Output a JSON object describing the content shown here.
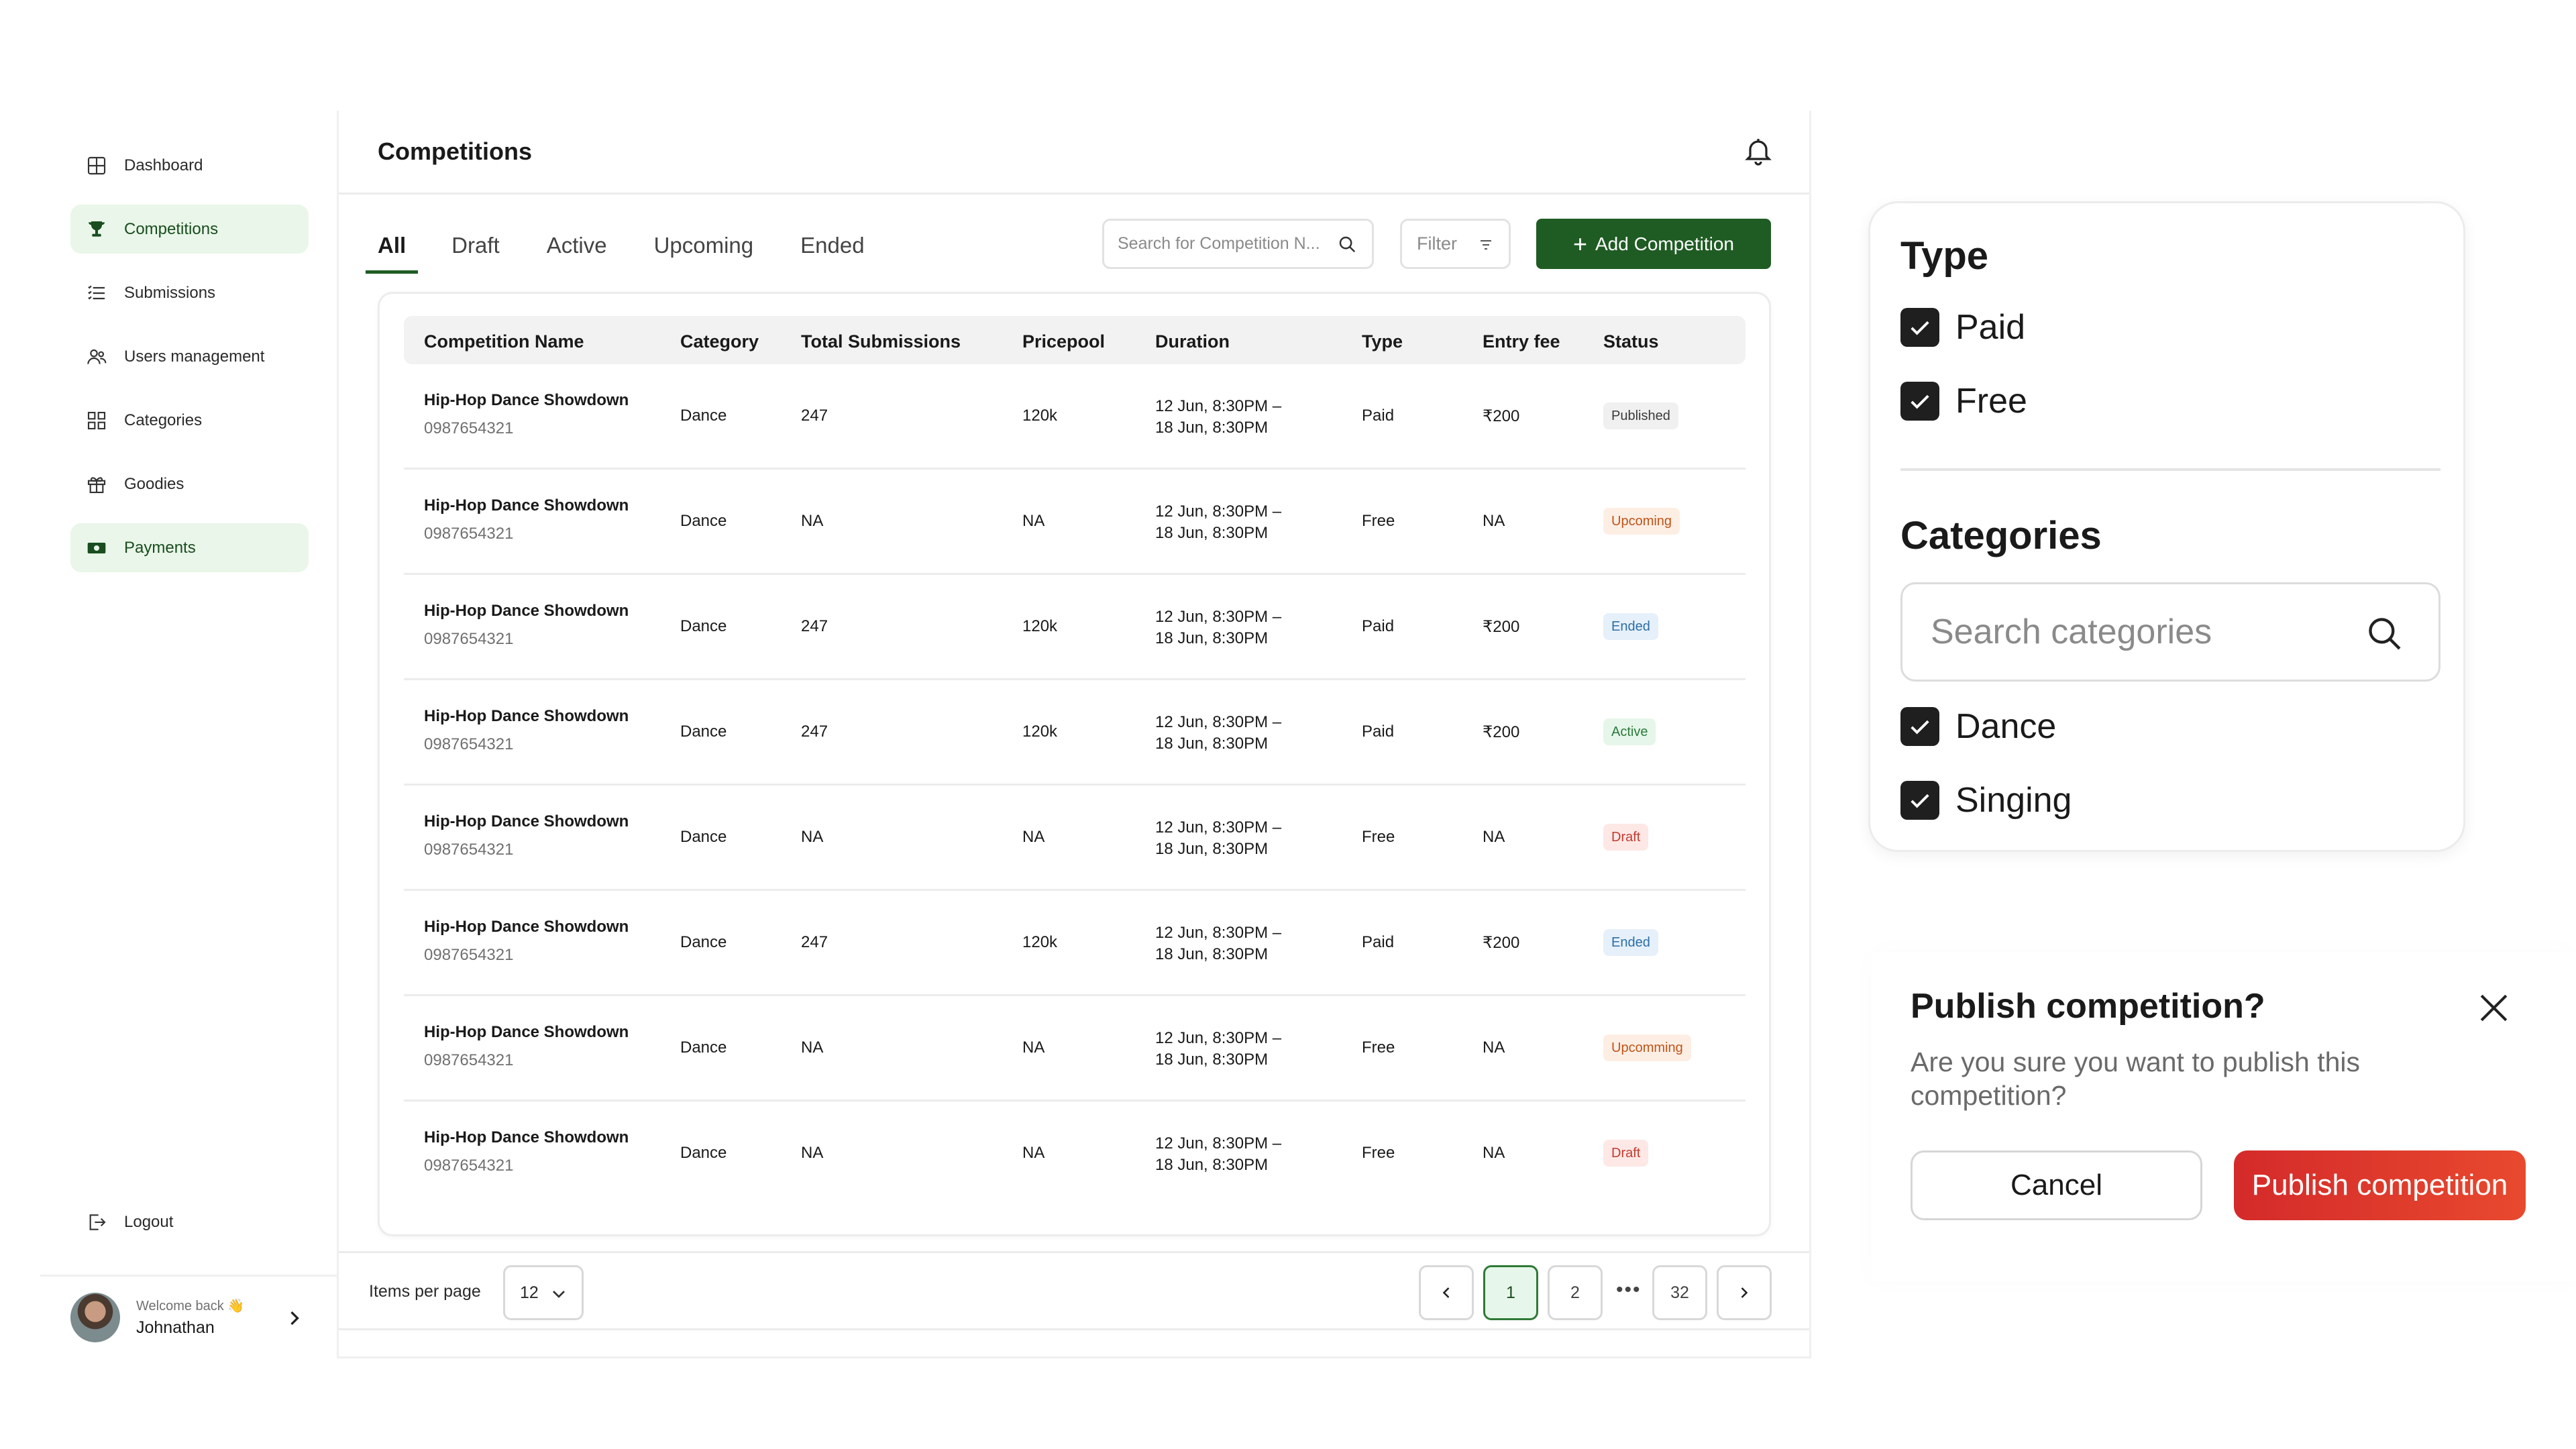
{
  "sidebar": {
    "items": [
      {
        "label": "Dashboard",
        "icon": "dashboard-icon",
        "active": false
      },
      {
        "label": "Competitions",
        "icon": "trophy-icon",
        "active": true
      },
      {
        "label": "Submissions",
        "icon": "list-icon",
        "active": false
      },
      {
        "label": "Users management",
        "icon": "users-icon",
        "active": false
      },
      {
        "label": "Categories",
        "icon": "grid-icon",
        "active": false
      },
      {
        "label": "Goodies",
        "icon": "gift-icon",
        "active": false
      },
      {
        "label": "Payments",
        "icon": "money-icon",
        "active": true
      }
    ],
    "logout_label": "Logout",
    "user": {
      "welcome": "Welcome back 👋",
      "name": "Johnathan"
    }
  },
  "header": {
    "title": "Competitions"
  },
  "tabs": [
    {
      "label": "All",
      "active": true
    },
    {
      "label": "Draft",
      "active": false
    },
    {
      "label": "Active",
      "active": false
    },
    {
      "label": "Upcoming",
      "active": false
    },
    {
      "label": "Ended",
      "active": false
    }
  ],
  "search": {
    "placeholder": "Search for Competition N..."
  },
  "filter_label": "Filter",
  "add_button_label": "Add Competition",
  "table": {
    "columns": [
      "Competition Name",
      "Category",
      "Total Submissions",
      "Pricepool",
      "Duration",
      "Type",
      "Entry fee",
      "Status"
    ],
    "rows": [
      {
        "name": "Hip-Hop Dance Showdown",
        "id": "0987654321",
        "category": "Dance",
        "submissions": "247",
        "pricepool": "120k",
        "duration1": "12 Jun, 8:30PM –",
        "duration2": "18 Jun, 8:30PM",
        "type": "Paid",
        "fee": "₹200",
        "status": "Published",
        "status_kind": "pub"
      },
      {
        "name": "Hip-Hop Dance Showdown",
        "id": "0987654321",
        "category": "Dance",
        "submissions": "NA",
        "pricepool": "NA",
        "duration1": "12 Jun, 8:30PM –",
        "duration2": "18 Jun, 8:30PM",
        "type": "Free",
        "fee": "NA",
        "status": "Upcoming",
        "status_kind": "up"
      },
      {
        "name": "Hip-Hop Dance Showdown",
        "id": "0987654321",
        "category": "Dance",
        "submissions": "247",
        "pricepool": "120k",
        "duration1": "12 Jun, 8:30PM –",
        "duration2": "18 Jun, 8:30PM",
        "type": "Paid",
        "fee": "₹200",
        "status": "Ended",
        "status_kind": "end"
      },
      {
        "name": "Hip-Hop Dance Showdown",
        "id": "0987654321",
        "category": "Dance",
        "submissions": "247",
        "pricepool": "120k",
        "duration1": "12 Jun, 8:30PM –",
        "duration2": "18 Jun, 8:30PM",
        "type": "Paid",
        "fee": "₹200",
        "status": "Active",
        "status_kind": "act"
      },
      {
        "name": "Hip-Hop Dance Showdown",
        "id": "0987654321",
        "category": "Dance",
        "submissions": "NA",
        "pricepool": "NA",
        "duration1": "12 Jun, 8:30PM –",
        "duration2": "18 Jun, 8:30PM",
        "type": "Free",
        "fee": "NA",
        "status": "Draft",
        "status_kind": "draft"
      },
      {
        "name": "Hip-Hop Dance Showdown",
        "id": "0987654321",
        "category": "Dance",
        "submissions": "247",
        "pricepool": "120k",
        "duration1": "12 Jun, 8:30PM –",
        "duration2": "18 Jun, 8:30PM",
        "type": "Paid",
        "fee": "₹200",
        "status": "Ended",
        "status_kind": "end"
      },
      {
        "name": "Hip-Hop Dance Showdown",
        "id": "0987654321",
        "category": "Dance",
        "submissions": "NA",
        "pricepool": "NA",
        "duration1": "12 Jun, 8:30PM –",
        "duration2": "18 Jun, 8:30PM",
        "type": "Free",
        "fee": "NA",
        "status": "Upcomming",
        "status_kind": "up"
      },
      {
        "name": "Hip-Hop Dance Showdown",
        "id": "0987654321",
        "category": "Dance",
        "submissions": "NA",
        "pricepool": "NA",
        "duration1": "12 Jun, 8:30PM –",
        "duration2": "18 Jun, 8:30PM",
        "type": "Free",
        "fee": "NA",
        "status": "Draft",
        "status_kind": "draft"
      }
    ]
  },
  "pagination": {
    "items_per_page_label": "Items per page",
    "items_per_page_value": "12",
    "pages": [
      "1",
      "2",
      "32"
    ],
    "current": "1",
    "ellipsis": "•••"
  },
  "filter_panel": {
    "type_heading": "Type",
    "type_options": [
      {
        "label": "Paid",
        "checked": true
      },
      {
        "label": "Free",
        "checked": true
      }
    ],
    "categories_heading": "Categories",
    "categories_search_placeholder": "Search categories",
    "category_options": [
      {
        "label": "Dance",
        "checked": true
      },
      {
        "label": "Singing",
        "checked": true
      }
    ]
  },
  "publish_dialog": {
    "title": "Publish competition?",
    "message": "Are you sure you want to publish this competition?",
    "cancel_label": "Cancel",
    "confirm_label": "Publish competition"
  },
  "colors": {
    "brand_green": "#1f5c23",
    "active_nav_bg": "#e9f6e9",
    "publish_red": "#e03a2c"
  }
}
